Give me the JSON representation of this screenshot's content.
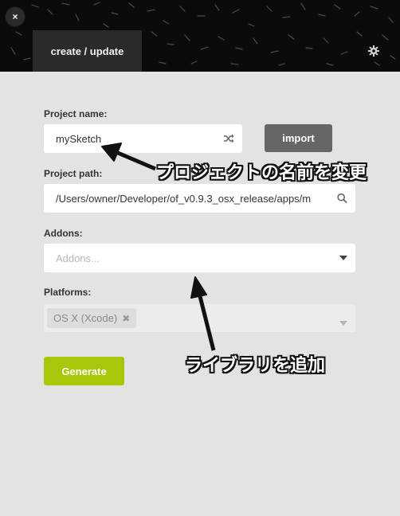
{
  "window": {
    "tab_label": "create / update",
    "close_glyph": "×"
  },
  "form": {
    "project_name_label": "Project name:",
    "project_name_value": "mySketch",
    "import_label": "import",
    "project_path_label": "Project path:",
    "project_path_value": "/Users/owner/Developer/of_v0.9.3_osx_release/apps/m",
    "addons_label": "Addons:",
    "addons_placeholder": "Addons...",
    "platforms_label": "Platforms:",
    "platform_chip": "OS X (Xcode)",
    "platform_chip_remove": "✖",
    "generate_label": "Generate"
  },
  "annotations": {
    "rename": "プロジェクトの名前を変更",
    "add_library": "ライブラリを追加"
  },
  "icons": {
    "close": "close-icon",
    "settings": "gear-icon",
    "shuffle": "shuffle-icon",
    "search": "search-icon",
    "addons_dropdown": "caret-down-icon",
    "platforms_dropdown": "caret-down-icon"
  },
  "colors": {
    "generate": "#a8c70a",
    "import": "#666666",
    "tab": "#2a2a2a",
    "panel": "#e3e3e3"
  }
}
